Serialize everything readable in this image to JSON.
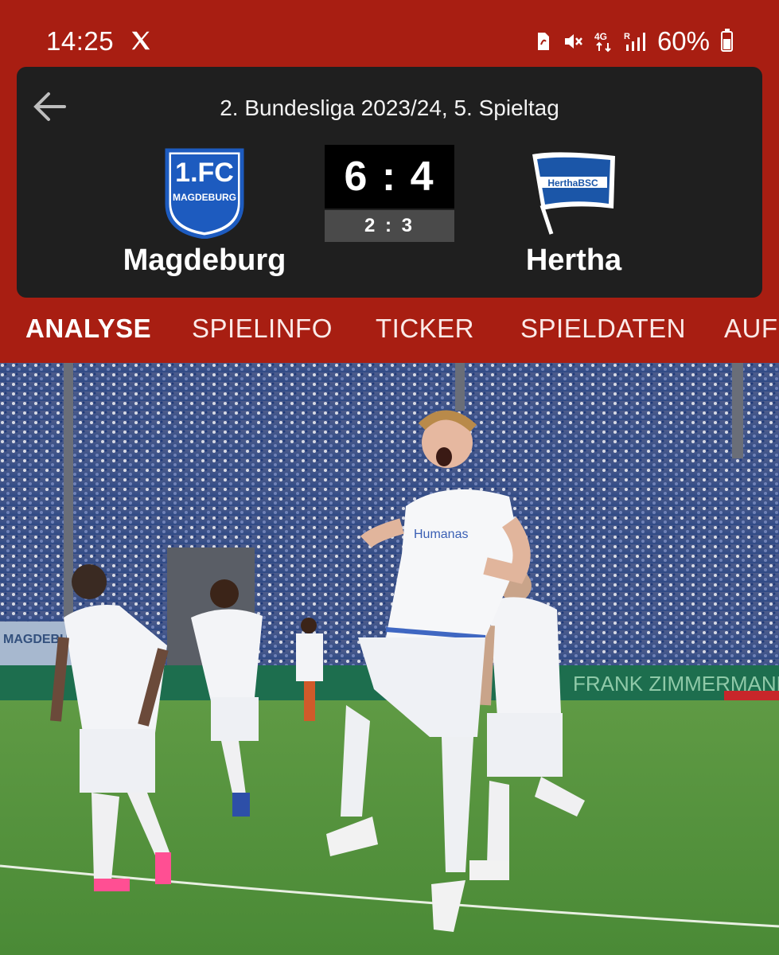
{
  "status_bar": {
    "time": "14:25",
    "icons": [
      "x-logo-icon",
      "sim-icon",
      "mute-icon",
      "4g-icon",
      "signal-icon",
      "battery-icon"
    ],
    "battery_percent": "60%",
    "battery_level": 0.6
  },
  "match": {
    "league": "2. Bundesliga 2023/24, 5. Spieltag",
    "home": {
      "name": "Magdeburg",
      "crest_lines": [
        "1.FC",
        "MAGDEBURG"
      ],
      "color": "#1d5bbf"
    },
    "away": {
      "name": "Hertha",
      "crest_text": "HerthaBSC",
      "color": "#1b56a8"
    },
    "score": "6 : 4",
    "halftime_score": "2 : 3"
  },
  "tabs": [
    {
      "label": "ANALYSE",
      "active": true
    },
    {
      "label": "SPIELINFO",
      "active": false
    },
    {
      "label": "TICKER",
      "active": false
    },
    {
      "label": "SPIELDATEN",
      "active": false
    },
    {
      "label": "AUFS",
      "active": false
    }
  ],
  "photo": {
    "banner_text": "FRANK ZIMMERMANN",
    "board_text": "MAGDEBURG",
    "shirt_sponsor": "Humanas"
  },
  "colors": {
    "app_bar": "#a81e12",
    "card_bg": "#1f1f1f",
    "pitch": "#4e8f3a"
  }
}
